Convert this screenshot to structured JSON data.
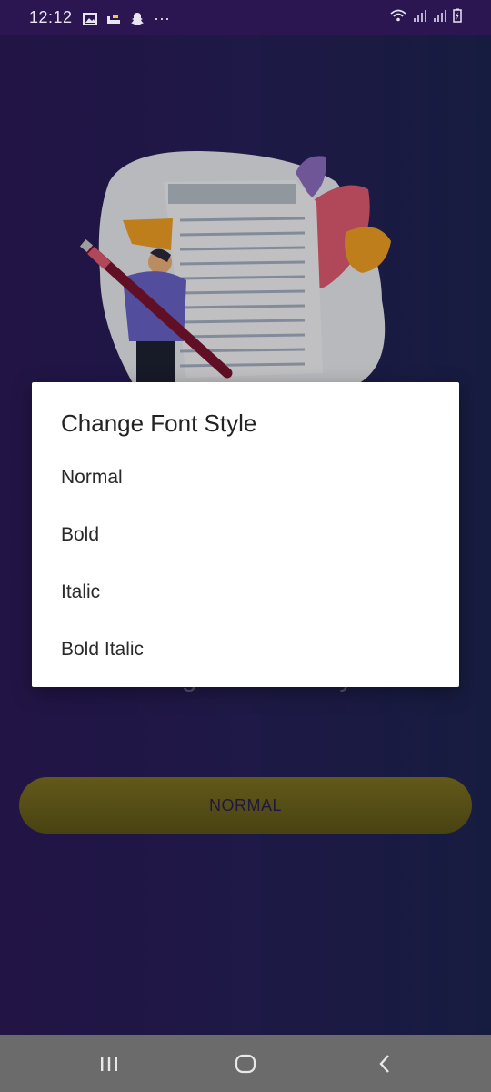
{
  "status_bar": {
    "time": "12:12",
    "dots": "···",
    "left_icons": [
      "image-icon",
      "sleep-icon",
      "snapchat-icon"
    ],
    "right_icons": [
      "wifi-icon",
      "signal-icon",
      "signal-icon",
      "battery-charging-icon"
    ]
  },
  "background": {
    "caption": "Change the font style",
    "button_label": "NORMAL"
  },
  "dialog": {
    "title": "Change Font Style",
    "options": [
      "Normal",
      "Bold",
      "Italic",
      "Bold Italic"
    ]
  },
  "nav_bar": {
    "icons": [
      "recent-apps-icon",
      "home-icon",
      "back-icon"
    ]
  },
  "colors": {
    "background_start": "#2c1a59",
    "background_end": "#1d2452",
    "button": "#7e7221",
    "button_text": "#2a1e52",
    "dialog_bg": "#ffffff",
    "nav_bar": "#6b6b6b"
  }
}
